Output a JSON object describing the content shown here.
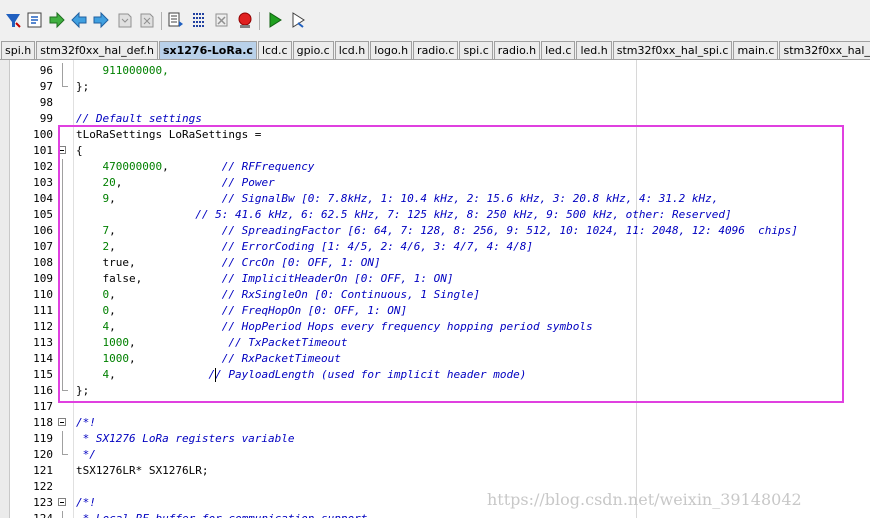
{
  "toolbar": {
    "icons": [
      "find-in-files-icon",
      "incremental-find-icon",
      "go-forward-icon",
      "navigate-back-icon",
      "navigate-forward-icon",
      "bookmark-icon",
      "bookmark-clear-icon",
      "indent-icon",
      "unindent-icon",
      "comment-icon",
      "uncomment-icon",
      "debug-stop-icon",
      "build-icon",
      "rebuild-icon"
    ]
  },
  "tabs": [
    {
      "label": "spi.h",
      "active": false
    },
    {
      "label": "stm32f0xx_hal_def.h",
      "active": false
    },
    {
      "label": "sx1276-LoRa.c",
      "active": true
    },
    {
      "label": "lcd.c",
      "active": false
    },
    {
      "label": "gpio.c",
      "active": false
    },
    {
      "label": "lcd.h",
      "active": false
    },
    {
      "label": "logo.h",
      "active": false
    },
    {
      "label": "radio.c",
      "active": false
    },
    {
      "label": "spi.c",
      "active": false
    },
    {
      "label": "radio.h",
      "active": false
    },
    {
      "label": "led.c",
      "active": false
    },
    {
      "label": "led.h",
      "active": false
    },
    {
      "label": "stm32f0xx_hal_spi.c",
      "active": false
    },
    {
      "label": "main.c",
      "active": false
    },
    {
      "label": "stm32f0xx_hal_gpio.c",
      "active": false
    },
    {
      "label": "stm3",
      "active": false
    }
  ],
  "code_lines": [
    {
      "n": "96",
      "fold": "line",
      "segs": [
        {
          "t": "    ",
          "c": "plain"
        },
        {
          "t": "911000000,",
          "c": "num"
        }
      ]
    },
    {
      "n": "97",
      "fold": "end",
      "segs": [
        {
          "t": "};",
          "c": "plain"
        }
      ]
    },
    {
      "n": "98",
      "fold": "",
      "segs": []
    },
    {
      "n": "99",
      "fold": "",
      "segs": [
        {
          "t": "// Default settings",
          "c": "cmt"
        }
      ]
    },
    {
      "n": "100",
      "fold": "",
      "segs": [
        {
          "t": "tLoRaSettings LoRaSettings =",
          "c": "plain"
        }
      ]
    },
    {
      "n": "101",
      "fold": "box",
      "segs": [
        {
          "t": "{",
          "c": "plain"
        }
      ]
    },
    {
      "n": "102",
      "fold": "line",
      "segs": [
        {
          "t": "    ",
          "c": "plain"
        },
        {
          "t": "470000000",
          "c": "num"
        },
        {
          "t": ",        ",
          "c": "plain"
        },
        {
          "t": "// RFFrequency",
          "c": "cmt"
        }
      ]
    },
    {
      "n": "103",
      "fold": "line",
      "segs": [
        {
          "t": "    ",
          "c": "plain"
        },
        {
          "t": "20",
          "c": "num"
        },
        {
          "t": ",               ",
          "c": "plain"
        },
        {
          "t": "// Power",
          "c": "cmt"
        }
      ]
    },
    {
      "n": "104",
      "fold": "line",
      "segs": [
        {
          "t": "    ",
          "c": "plain"
        },
        {
          "t": "9",
          "c": "num"
        },
        {
          "t": ",                ",
          "c": "plain"
        },
        {
          "t": "// SignalBw [0: 7.8kHz, 1: 10.4 kHz, 2: 15.6 kHz, 3: 20.8 kHz, 4: 31.2 kHz,",
          "c": "cmt"
        }
      ]
    },
    {
      "n": "105",
      "fold": "line",
      "segs": [
        {
          "t": "                  ",
          "c": "plain"
        },
        {
          "t": "// 5: 41.6 kHz, 6: 62.5 kHz, 7: 125 kHz, 8: 250 kHz, 9: 500 kHz, other: Reserved]",
          "c": "cmt"
        }
      ]
    },
    {
      "n": "106",
      "fold": "line",
      "segs": [
        {
          "t": "    ",
          "c": "plain"
        },
        {
          "t": "7",
          "c": "num"
        },
        {
          "t": ",                ",
          "c": "plain"
        },
        {
          "t": "// SpreadingFactor [6: 64, 7: 128, 8: 256, 9: 512, 10: 1024, 11: 2048, 12: 4096  chips]",
          "c": "cmt"
        }
      ]
    },
    {
      "n": "107",
      "fold": "line",
      "segs": [
        {
          "t": "    ",
          "c": "plain"
        },
        {
          "t": "2",
          "c": "num"
        },
        {
          "t": ",                ",
          "c": "plain"
        },
        {
          "t": "// ErrorCoding [1: 4/5, 2: 4/6, 3: 4/7, 4: 4/8]",
          "c": "cmt"
        }
      ]
    },
    {
      "n": "108",
      "fold": "line",
      "segs": [
        {
          "t": "    true,             ",
          "c": "plain"
        },
        {
          "t": "// CrcOn [0: OFF, 1: ON]",
          "c": "cmt"
        }
      ]
    },
    {
      "n": "109",
      "fold": "line",
      "segs": [
        {
          "t": "    false,            ",
          "c": "plain"
        },
        {
          "t": "// ImplicitHeaderOn [0: OFF, 1: ON]",
          "c": "cmt"
        }
      ]
    },
    {
      "n": "110",
      "fold": "line",
      "segs": [
        {
          "t": "    ",
          "c": "plain"
        },
        {
          "t": "0",
          "c": "num"
        },
        {
          "t": ",                ",
          "c": "plain"
        },
        {
          "t": "// RxSingleOn [0: Continuous, 1 Single]",
          "c": "cmt"
        }
      ]
    },
    {
      "n": "111",
      "fold": "line",
      "segs": [
        {
          "t": "    ",
          "c": "plain"
        },
        {
          "t": "0",
          "c": "num"
        },
        {
          "t": ",                ",
          "c": "plain"
        },
        {
          "t": "// FreqHopOn [0: OFF, 1: ON]",
          "c": "cmt"
        }
      ]
    },
    {
      "n": "112",
      "fold": "line",
      "segs": [
        {
          "t": "    ",
          "c": "plain"
        },
        {
          "t": "4",
          "c": "num"
        },
        {
          "t": ",                ",
          "c": "plain"
        },
        {
          "t": "// HopPeriod Hops every frequency hopping period symbols",
          "c": "cmt"
        }
      ]
    },
    {
      "n": "113",
      "fold": "line",
      "segs": [
        {
          "t": "    ",
          "c": "plain"
        },
        {
          "t": "1000",
          "c": "num"
        },
        {
          "t": ",              ",
          "c": "plain"
        },
        {
          "t": "// TxPacketTimeout",
          "c": "cmt"
        }
      ]
    },
    {
      "n": "114",
      "fold": "line",
      "segs": [
        {
          "t": "    ",
          "c": "plain"
        },
        {
          "t": "1000",
          "c": "num"
        },
        {
          "t": ",             ",
          "c": "plain"
        },
        {
          "t": "// RxPacketTimeout",
          "c": "cmt"
        }
      ]
    },
    {
      "n": "115",
      "fold": "line",
      "caret": true,
      "segs": [
        {
          "t": "    ",
          "c": "plain"
        },
        {
          "t": "4",
          "c": "num"
        },
        {
          "t": ",              ",
          "c": "plain"
        },
        {
          "t": "// PayloadLength (used for implicit header mode)",
          "c": "cmt"
        }
      ]
    },
    {
      "n": "116",
      "fold": "end",
      "segs": [
        {
          "t": "};",
          "c": "plain"
        }
      ]
    },
    {
      "n": "117",
      "fold": "",
      "segs": []
    },
    {
      "n": "118",
      "fold": "box",
      "segs": [
        {
          "t": "/*!",
          "c": "cmt"
        }
      ]
    },
    {
      "n": "119",
      "fold": "line",
      "segs": [
        {
          "t": " * SX1276 LoRa registers variable",
          "c": "cmt"
        }
      ]
    },
    {
      "n": "120",
      "fold": "end",
      "segs": [
        {
          "t": " */",
          "c": "cmt"
        }
      ]
    },
    {
      "n": "121",
      "fold": "",
      "segs": [
        {
          "t": "tSX1276LR* SX1276LR;",
          "c": "plain"
        }
      ]
    },
    {
      "n": "122",
      "fold": "",
      "segs": []
    },
    {
      "n": "123",
      "fold": "box",
      "segs": [
        {
          "t": "/*!",
          "c": "cmt"
        }
      ]
    },
    {
      "n": "124",
      "fold": "line",
      "segs": [
        {
          "t": " * Local RF buffer for communication support",
          "c": "cmt"
        }
      ]
    }
  ],
  "watermark": "https://blog.csdn.net/weixin_39148042",
  "colors": {
    "highlight_box": "#e040e0",
    "comment": "#0000c0",
    "number": "#008000",
    "active_tab": "#b9d1ea"
  }
}
